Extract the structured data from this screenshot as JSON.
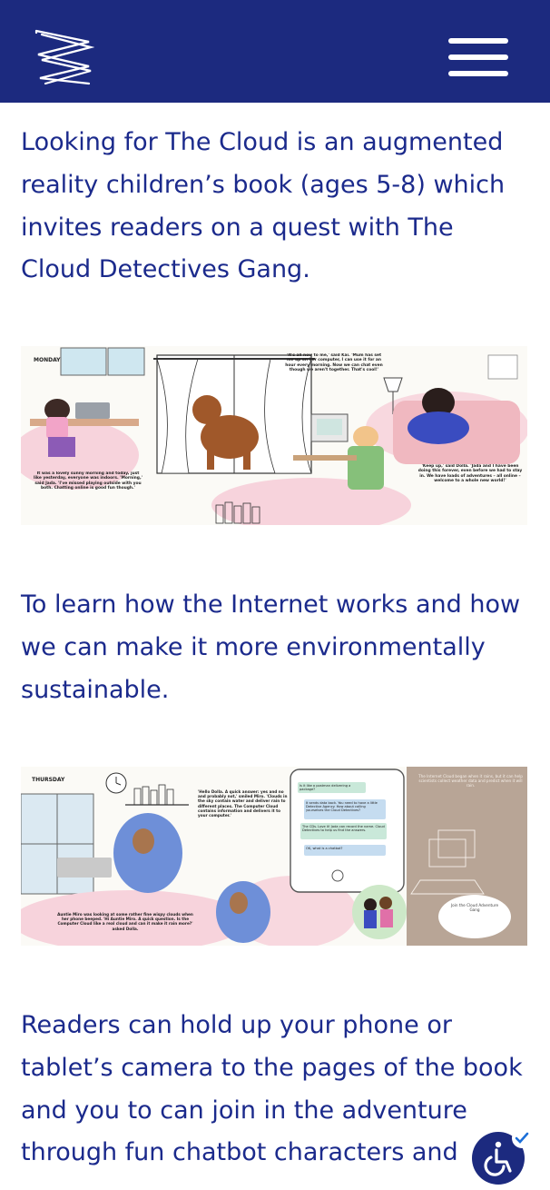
{
  "header": {
    "logo_icon": "zigzag-logo-icon",
    "menu_icon": "hamburger-menu-icon",
    "bg_color": "#1c2a7f"
  },
  "content": {
    "para1": "Looking for The Cloud is an augmented reality children’s book (ages 5-8) which invites readers on a quest with The Cloud Detectives Gang.",
    "para2": "To learn how the Internet works and how we can make it more environmentally sustainable.",
    "para3": "Readers can hold up your phone or tablet’s camera to the pages of the book and you to can join in the adventure through fun chatbot characters and"
  },
  "illustration1": {
    "day": "MONDAY",
    "caption_left": "It was a lovely sunny morning and today, just like yesterday, everyone was indoors. 'Morning,' said Jada. 'I've missed playing outside with you both. Chatting online is good fun though.'",
    "caption_middle": "'It's all new to me,' said Kai. 'Mum has set me up on her computer, I can use it for an hour every morning. Now we can chat even though we aren't together. That's cool!'",
    "caption_right": "'Keep up,' said Dolla. 'Jada and I have been doing this forever, even before we had to stay in. We have loads of adventures – all online – welcome to a whole new world!'"
  },
  "illustration2": {
    "day": "THURSDAY",
    "caption_left": "Auntie Miro was looking at some rather fine wispy clouds when her phone beeped. 'Hi Auntie Miro. A quick question. Is the Computer Cloud like a real cloud and can it make it rain more?' asked Dolla.",
    "caption_middle": "'Hello Dolla. A quick answer: yes and no and probably not,' smiled Miro. 'Clouds in the sky contain water and deliver rain to different places. The Computer Cloud contains information and delivers it to your computer.'",
    "chat": [
      "Is it like a postman delivering a package?",
      "It sends data back. You need to have a little Detective Agency. How about calling yourselves the Cloud Detectives?",
      "The CDs. Love it! Jada can record the name. Cloud Detectives to help us find the answers.",
      "OK, what is a chatbot?"
    ],
    "side_text": "The Internet Cloud began when it rains, but it can help scientists collect weather data and predict when it will rain.",
    "badge": "Join the Cloud Adventure Gang"
  },
  "accessibility": {
    "icon": "accessibility-wheelchair-icon",
    "check_icon": "check-icon"
  }
}
